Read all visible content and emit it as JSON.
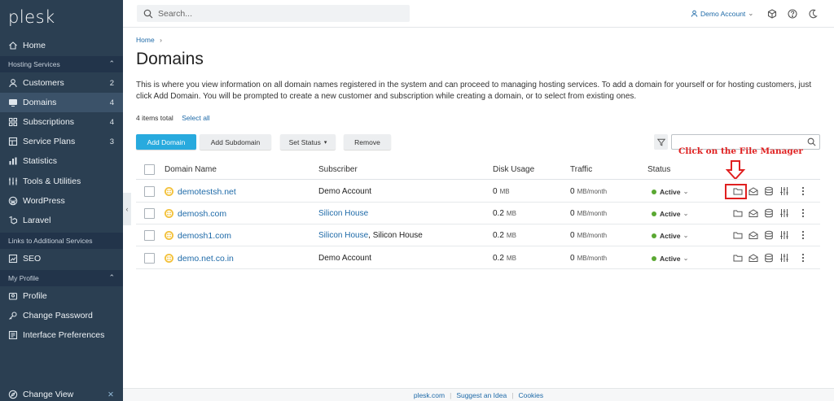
{
  "app": {
    "logo": "plesk"
  },
  "sidebar": {
    "items": [
      {
        "label": "Home",
        "icon": "home-icon"
      },
      {
        "label": "Customers",
        "count": "2",
        "icon": "user-icon"
      },
      {
        "label": "Domains",
        "count": "4",
        "icon": "monitor-icon",
        "active": true
      },
      {
        "label": "Subscriptions",
        "count": "4",
        "icon": "grid-icon"
      },
      {
        "label": "Service Plans",
        "count": "3",
        "icon": "plans-icon"
      },
      {
        "label": "Statistics",
        "icon": "bar-chart-icon"
      },
      {
        "label": "Tools & Utilities",
        "icon": "tools-icon"
      },
      {
        "label": "WordPress",
        "icon": "wordpress-icon"
      },
      {
        "label": "Laravel",
        "icon": "laravel-icon"
      },
      {
        "label": "SEO",
        "icon": "seo-icon"
      },
      {
        "label": "Profile",
        "icon": "profile-icon"
      },
      {
        "label": "Change Password",
        "icon": "key-icon"
      },
      {
        "label": "Interface Preferences",
        "icon": "preferences-icon"
      }
    ],
    "sections": {
      "hosting": "Hosting Services",
      "links": "Links to Additional Services",
      "profile": "My Profile"
    },
    "change_view": "Change View"
  },
  "topbar": {
    "search_placeholder": "Search...",
    "account": "Demo Account"
  },
  "breadcrumb": {
    "home": "Home",
    "sep": "›"
  },
  "page": {
    "title": "Domains",
    "description": "This is where you view information on all domain names registered in the system and can proceed to managing hosting services. To add a domain for yourself or for hosting customers, just click Add Domain. You will be prompted to create a new customer and subscription while creating a domain, or to select from existing ones.",
    "items_total": "4 items total",
    "select_all": "Select all"
  },
  "toolbar": {
    "add_domain": "Add Domain",
    "add_subdomain": "Add Subdomain",
    "set_status": "Set Status",
    "remove": "Remove"
  },
  "annotation": "Click on the File Manager",
  "table": {
    "headers": {
      "domain": "Domain Name",
      "subscriber": "Subscriber",
      "disk": "Disk Usage",
      "traffic": "Traffic",
      "status": "Status"
    },
    "rows": [
      {
        "domain": "demotestsh.net",
        "subscriber": "Demo Account",
        "subscriber_extra": "",
        "subscriber_link": false,
        "disk": "0",
        "disk_unit": "MB",
        "traffic": "0",
        "traffic_unit": "MB/month",
        "status": "Active"
      },
      {
        "domain": "demosh.com",
        "subscriber": "Silicon House",
        "subscriber_extra": "",
        "subscriber_link": true,
        "disk": "0.2",
        "disk_unit": "MB",
        "traffic": "0",
        "traffic_unit": "MB/month",
        "status": "Active"
      },
      {
        "domain": "demosh1.com",
        "subscriber": "Silicon House",
        "subscriber_extra": ", Silicon House",
        "subscriber_link": true,
        "disk": "0.2",
        "disk_unit": "MB",
        "traffic": "0",
        "traffic_unit": "MB/month",
        "status": "Active"
      },
      {
        "domain": "demo.net.co.in",
        "subscriber": "Demo Account",
        "subscriber_extra": "",
        "subscriber_link": false,
        "disk": "0.2",
        "disk_unit": "MB",
        "traffic": "0",
        "traffic_unit": "MB/month",
        "status": "Active"
      }
    ]
  },
  "footer": {
    "links": [
      "plesk.com",
      "Suggest an Idea",
      "Cookies"
    ]
  },
  "colors": {
    "sidebar": "#2b3f52",
    "accent": "#28aade",
    "link": "#1e6aa8",
    "annotation": "#e02020",
    "active": "#5aa832"
  }
}
